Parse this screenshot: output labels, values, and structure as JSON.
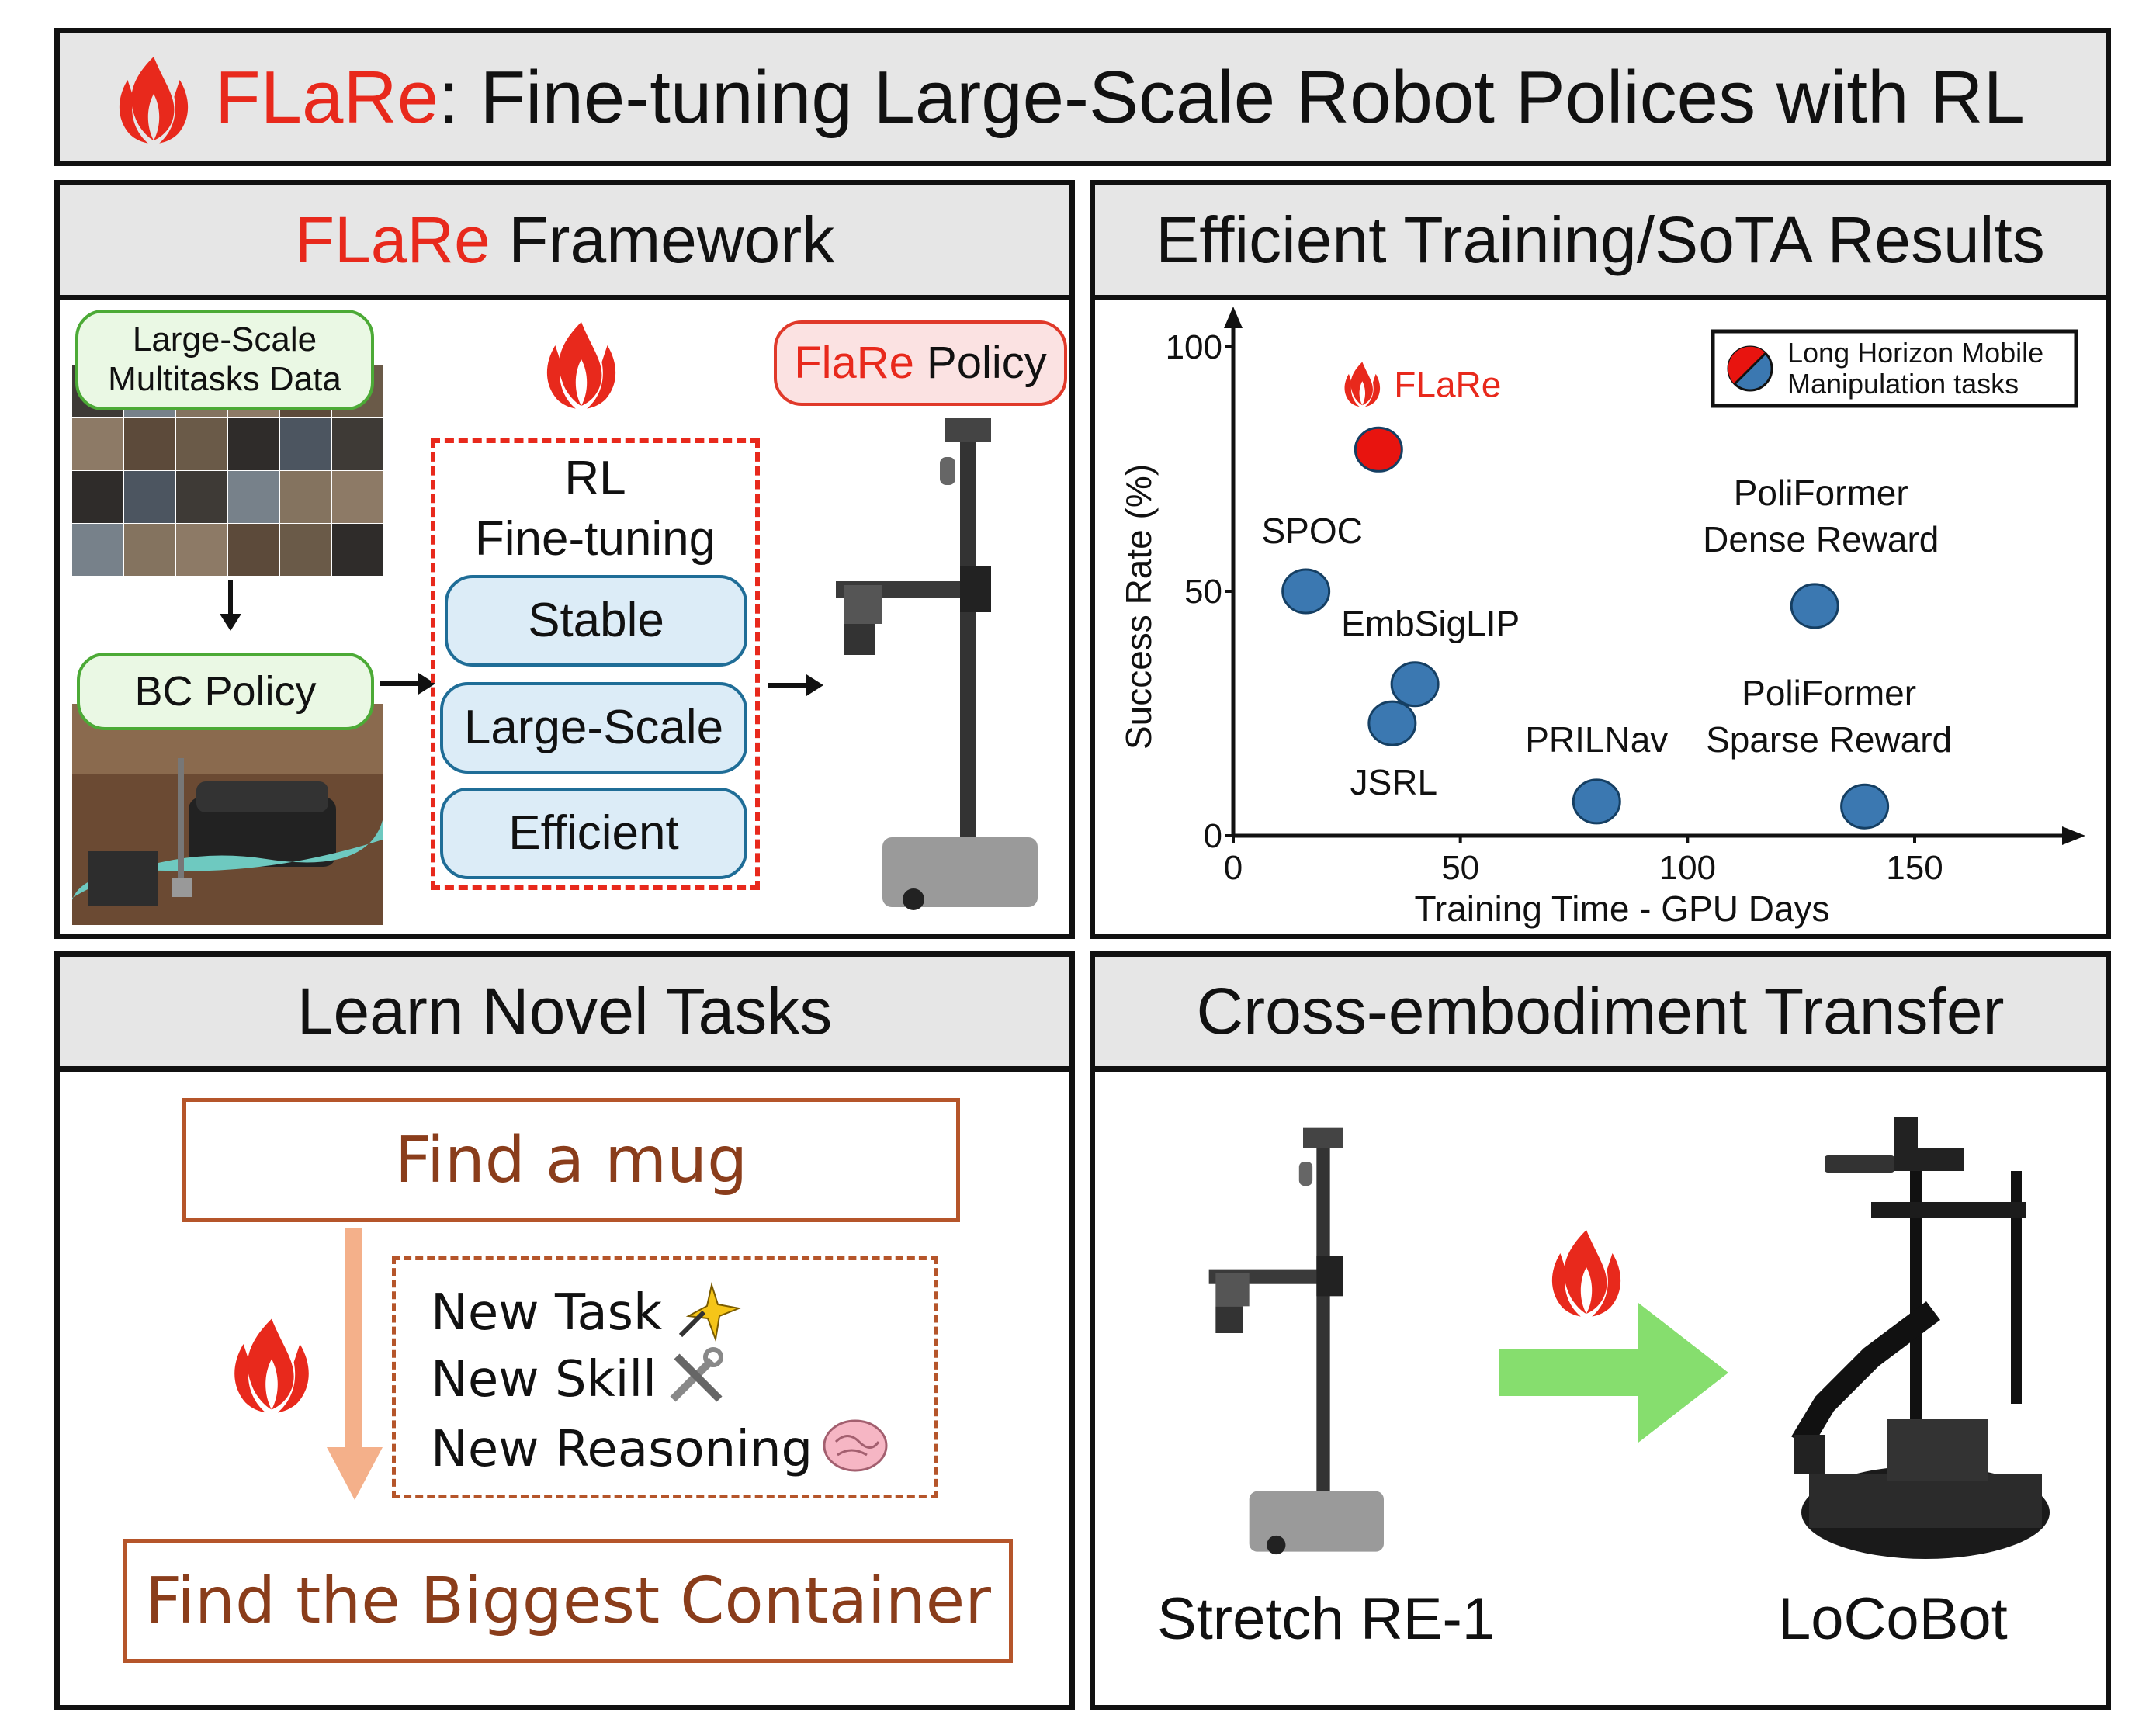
{
  "title": {
    "brand": "FLaRe",
    "rest": ": Fine-tuning Large-Scale Robot Polices with RL"
  },
  "panels": {
    "framework": {
      "header_brand": "FLaRe",
      "header_rest": " Framework",
      "data_label": "Large-Scale\nMultitasks Data",
      "bc_label": "BC Policy",
      "rl_title_1": "RL",
      "rl_title_2": "Fine-tuning",
      "properties": [
        "Stable",
        "Large-Scale",
        "Efficient"
      ],
      "policy_brand": "FlaRe",
      "policy_rest": " Policy"
    },
    "results": {
      "header": "Efficient Training/SoTA Results"
    },
    "novel": {
      "header": "Learn Novel Tasks",
      "from_task": "Find a mug",
      "to_task": "Find the Biggest Container",
      "items": [
        "New Task",
        "New Skill",
        "New Reasoning"
      ]
    },
    "transfer": {
      "header": "Cross-embodiment Transfer",
      "source_robot": "Stretch RE-1",
      "target_robot": "LoCoBot"
    }
  },
  "chart_data": {
    "type": "scatter",
    "xlabel": "Training Time - GPU Days",
    "ylabel": "Success Rate (%)",
    "xlim": [
      0,
      150
    ],
    "ylim": [
      0,
      100
    ],
    "xticks": [
      "0",
      "50",
      "100",
      "150"
    ],
    "yticks": [
      "0",
      "50",
      "100"
    ],
    "legend": {
      "text": "Long Horizon Mobile\nManipulation tasks",
      "placement": "top-right"
    },
    "points": [
      {
        "label": "FLaRe",
        "x": 32,
        "y": 79,
        "color": "#e8140f"
      },
      {
        "label": "SPOC",
        "x": 16,
        "y": 50,
        "color": "#3b78b1"
      },
      {
        "label": "EmbSigLIP",
        "x": 40,
        "y": 31,
        "color": "#3b78b1"
      },
      {
        "label": "JSRL",
        "x": 35,
        "y": 23,
        "color": "#3b78b1"
      },
      {
        "label": "PRILNav",
        "x": 80,
        "y": 7,
        "color": "#3b78b1"
      },
      {
        "label": "PoliFormer\nDense Reward",
        "x": 128,
        "y": 47,
        "color": "#3b78b1"
      },
      {
        "label": "PoliFormer\nSparse Reward",
        "x": 139,
        "y": 6,
        "color": "#3b78b1"
      }
    ]
  },
  "colors": {
    "accent": "#e8291c",
    "chart_blue": "#3b78b1",
    "arrow_green": "#86de6e",
    "arrow_orange": "#f4b08a"
  }
}
